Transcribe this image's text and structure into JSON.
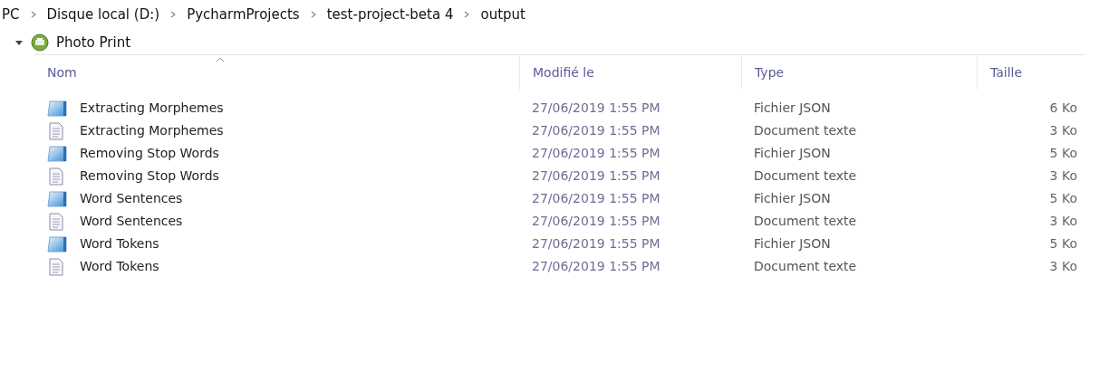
{
  "breadcrumb": [
    "PC",
    "Disque local (D:)",
    "PycharmProjects",
    "test-project-beta 4",
    "output"
  ],
  "group": {
    "title": "Photo Print",
    "expanded": true
  },
  "columns": [
    "Nom",
    "Modifié le",
    "Type",
    "Taille"
  ],
  "rows": [
    {
      "kind": "json",
      "name": "Extracting Morphemes",
      "modified": "27/06/2019 1:55 PM",
      "type": "Fichier JSON",
      "size": "6 Ko"
    },
    {
      "kind": "text",
      "name": "Extracting Morphemes",
      "modified": "27/06/2019 1:55 PM",
      "type": "Document texte",
      "size": "3 Ko"
    },
    {
      "kind": "json",
      "name": "Removing Stop Words",
      "modified": "27/06/2019 1:55 PM",
      "type": "Fichier JSON",
      "size": "5 Ko"
    },
    {
      "kind": "text",
      "name": "Removing Stop Words",
      "modified": "27/06/2019 1:55 PM",
      "type": "Document texte",
      "size": "3 Ko"
    },
    {
      "kind": "json",
      "name": "Word Sentences",
      "modified": "27/06/2019 1:55 PM",
      "type": "Fichier JSON",
      "size": "5 Ko"
    },
    {
      "kind": "text",
      "name": "Word Sentences",
      "modified": "27/06/2019 1:55 PM",
      "type": "Document texte",
      "size": "3 Ko"
    },
    {
      "kind": "json",
      "name": "Word Tokens",
      "modified": "27/06/2019 1:55 PM",
      "type": "Fichier JSON",
      "size": "5 Ko"
    },
    {
      "kind": "text",
      "name": "Word Tokens",
      "modified": "27/06/2019 1:55 PM",
      "type": "Document texte",
      "size": "3 Ko"
    }
  ]
}
